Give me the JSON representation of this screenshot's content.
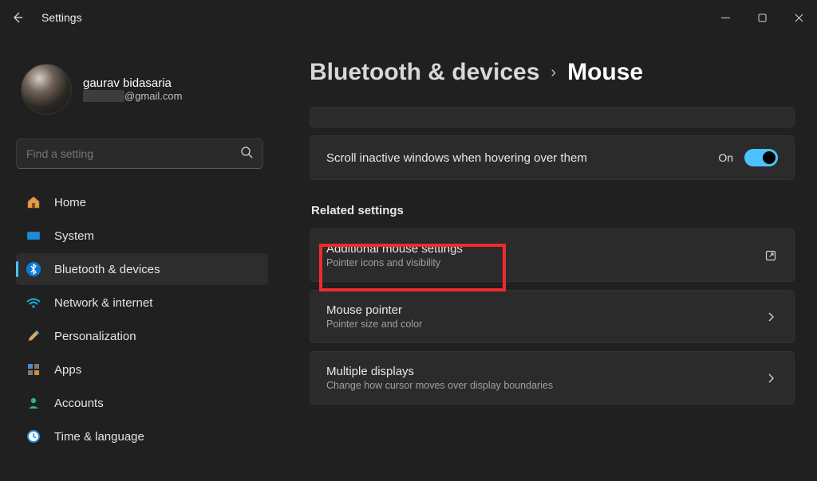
{
  "titlebar": {
    "app_name": "Settings"
  },
  "user": {
    "name": "gaurav bidasaria",
    "email_domain": "@gmail.com"
  },
  "search": {
    "placeholder": "Find a setting"
  },
  "nav": {
    "items": [
      {
        "id": "home",
        "label": "Home"
      },
      {
        "id": "system",
        "label": "System"
      },
      {
        "id": "bluetooth",
        "label": "Bluetooth & devices"
      },
      {
        "id": "network",
        "label": "Network & internet"
      },
      {
        "id": "personalization",
        "label": "Personalization"
      },
      {
        "id": "apps",
        "label": "Apps"
      },
      {
        "id": "accounts",
        "label": "Accounts"
      },
      {
        "id": "time",
        "label": "Time & language"
      }
    ],
    "active": "bluetooth"
  },
  "breadcrumb": {
    "parent": "Bluetooth & devices",
    "current": "Mouse"
  },
  "settings": {
    "scroll_inactive": {
      "label": "Scroll inactive windows when hovering over them",
      "state": "On"
    }
  },
  "related": {
    "heading": "Related settings",
    "items": [
      {
        "id": "additional",
        "title": "Additional mouse settings",
        "sub": "Pointer icons and visibility",
        "action": "open"
      },
      {
        "id": "pointer",
        "title": "Mouse pointer",
        "sub": "Pointer size and color",
        "action": "nav"
      },
      {
        "id": "displays",
        "title": "Multiple displays",
        "sub": "Change how cursor moves over display boundaries",
        "action": "nav"
      }
    ]
  }
}
